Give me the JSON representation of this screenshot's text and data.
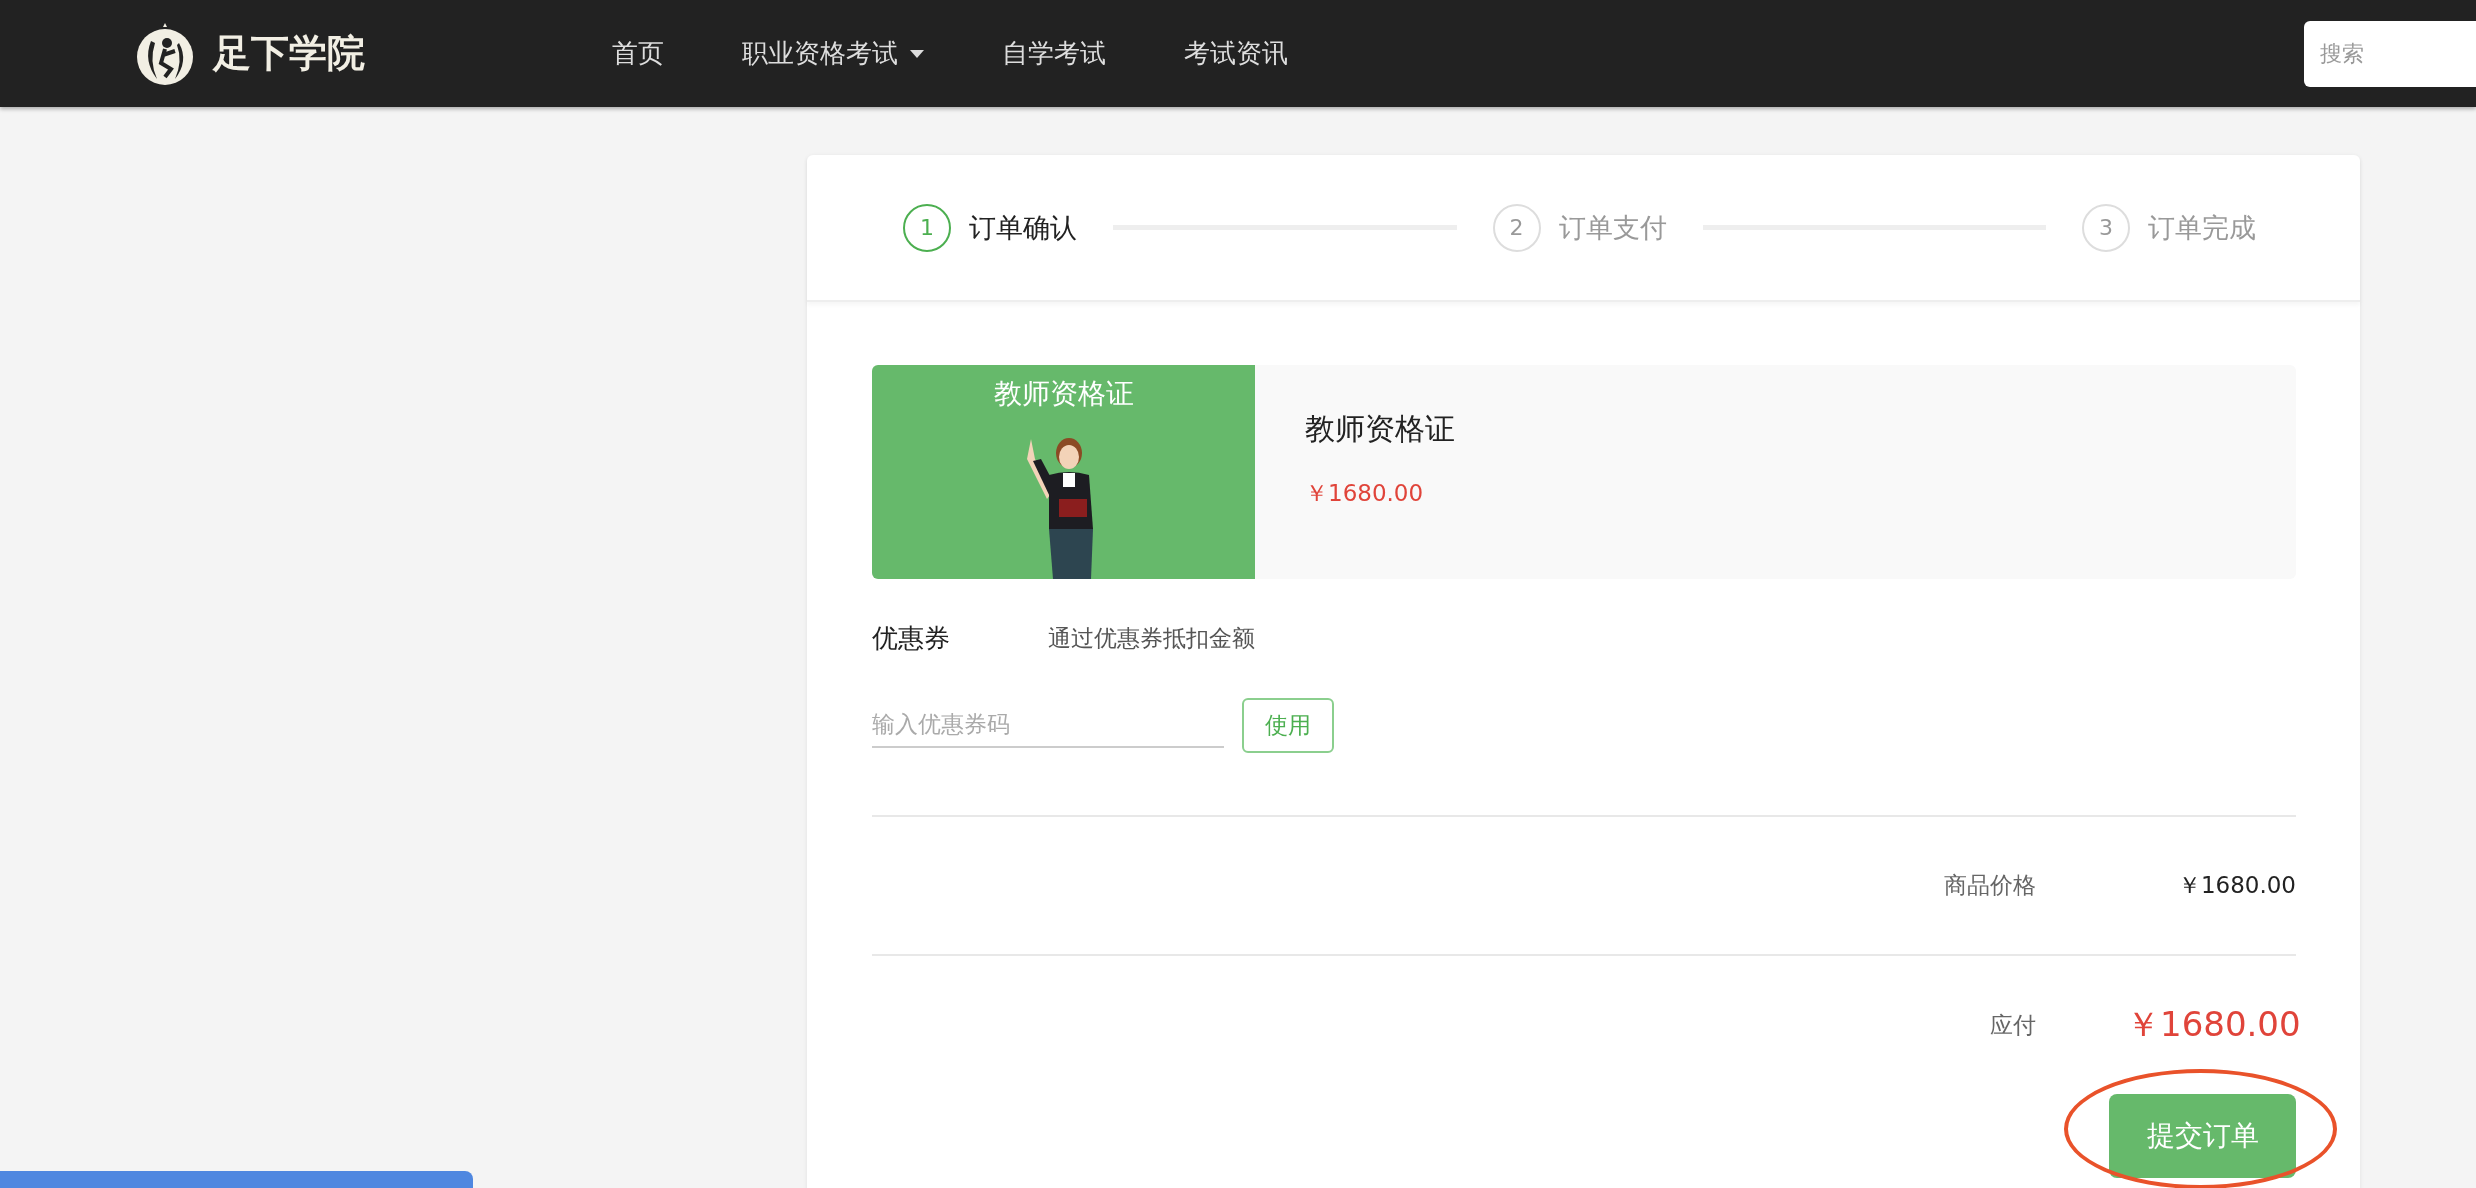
{
  "header": {
    "logo_text": "足下学院",
    "nav": [
      {
        "label": "首页",
        "dropdown": false
      },
      {
        "label": "职业资格考试",
        "dropdown": true
      },
      {
        "label": "自学考试",
        "dropdown": false
      },
      {
        "label": "考试资讯",
        "dropdown": false
      }
    ],
    "search": {
      "placeholder": "搜索"
    }
  },
  "steps": [
    {
      "number": "1",
      "label": "订单确认",
      "selected": true
    },
    {
      "number": "2",
      "label": "订单支付",
      "selected": false
    },
    {
      "number": "3",
      "label": "订单完成",
      "selected": false
    }
  ],
  "product": {
    "image_caption": "教师资格证",
    "title": "教师资格证",
    "price": "￥1680.00"
  },
  "coupon": {
    "label": "优惠券",
    "description": "通过优惠券抵扣金额",
    "placeholder": "输入优惠券码",
    "button": "使用"
  },
  "summary": [
    {
      "label": "商品价格",
      "value": "￥1680.00",
      "kind": "subtotal"
    },
    {
      "label": "应付",
      "value": "￥1680.00",
      "kind": "total"
    }
  ],
  "submit_button": "提交订单"
}
